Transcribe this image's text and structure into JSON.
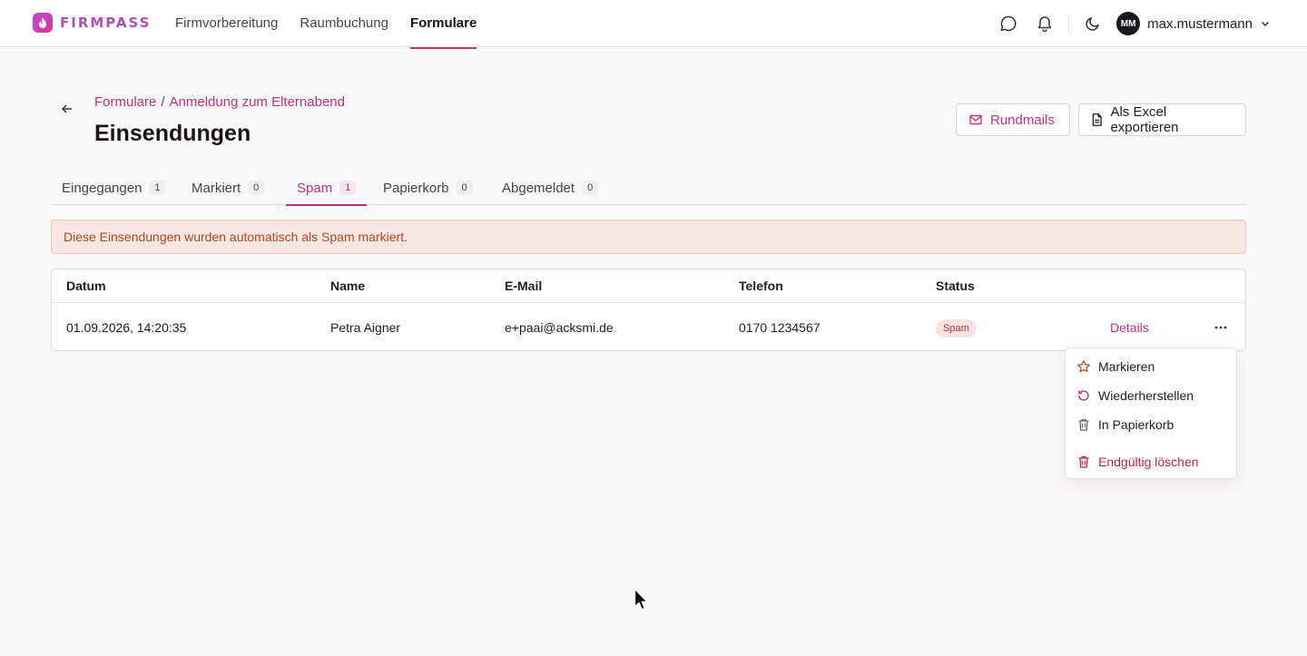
{
  "nav": {
    "logo_text": "FIRMPASS",
    "links": [
      "Firmvorbereitung",
      "Raumbuchung",
      "Formulare"
    ],
    "active_link": "Formulare",
    "user": {
      "initials": "MM",
      "name": "max.mustermann"
    }
  },
  "header": {
    "breadcrumb": [
      "Formulare",
      "Anmeldung zum Elternabend"
    ],
    "breadcrumb_separator": "/",
    "title": "Einsendungen",
    "buttons": {
      "rundmails": "Rundmails",
      "export": "Als Excel exportieren"
    }
  },
  "tabs": [
    {
      "label": "Eingegangen",
      "count": "1"
    },
    {
      "label": "Markiert",
      "count": "0"
    },
    {
      "label": "Spam",
      "count": "1",
      "active": true
    },
    {
      "label": "Papierkorb",
      "count": "0"
    },
    {
      "label": "Abgemeldet",
      "count": "0"
    }
  ],
  "alert": {
    "text": "Diese Einsendungen wurden automatisch als Spam markiert."
  },
  "table": {
    "columns": [
      "Datum",
      "Name",
      "E-Mail",
      "Telefon",
      "Status"
    ],
    "rows": [
      {
        "datum": "01.09.2026, 14:20:35",
        "name": "Petra Aigner",
        "email": "e+paai@acksmi.de",
        "telefon": "0170 1234567",
        "status": "Spam",
        "details": "Details"
      }
    ]
  },
  "menu": {
    "items": [
      {
        "label": "Markieren",
        "icon": "star-icon"
      },
      {
        "label": "Wiederherstellen",
        "icon": "restore-icon"
      },
      {
        "label": "In Papierkorb",
        "icon": "trash-icon"
      },
      {
        "label": "Endgültig löschen",
        "icon": "trash-icon",
        "danger": true
      }
    ]
  },
  "colors": {
    "accent": "#c2307c",
    "alert_bg": "#f7e6e2",
    "alert_text": "#b34a1a",
    "danger": "#c0283a"
  }
}
